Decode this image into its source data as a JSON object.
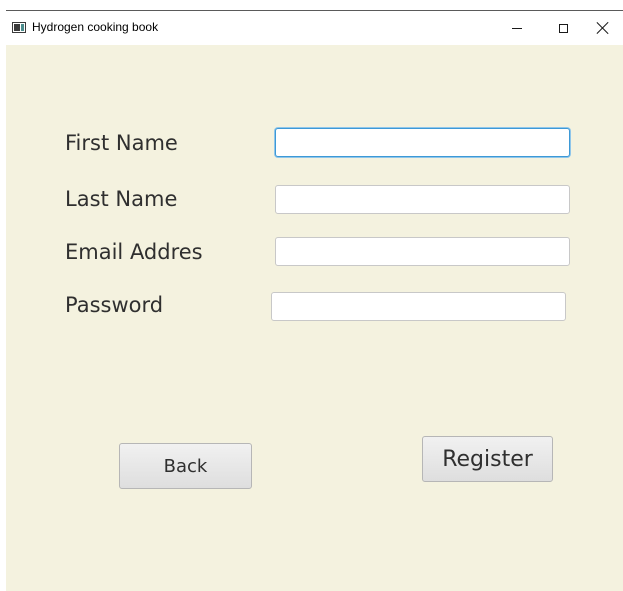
{
  "window": {
    "title": "Hydrogen cooking book",
    "controls": {
      "minimize": "minimize-icon",
      "maximize": "maximize-icon",
      "close": "close-icon"
    }
  },
  "form": {
    "first_name": {
      "label": "First Name",
      "value": ""
    },
    "last_name": {
      "label": "Last Name",
      "value": ""
    },
    "email": {
      "label": "Email Addres",
      "value": ""
    },
    "password": {
      "label": "Password",
      "value": ""
    }
  },
  "actions": {
    "back_label": "Back",
    "register_label": "Register"
  },
  "colors": {
    "background": "#f4f2df",
    "focus_border": "#3d99d6"
  }
}
